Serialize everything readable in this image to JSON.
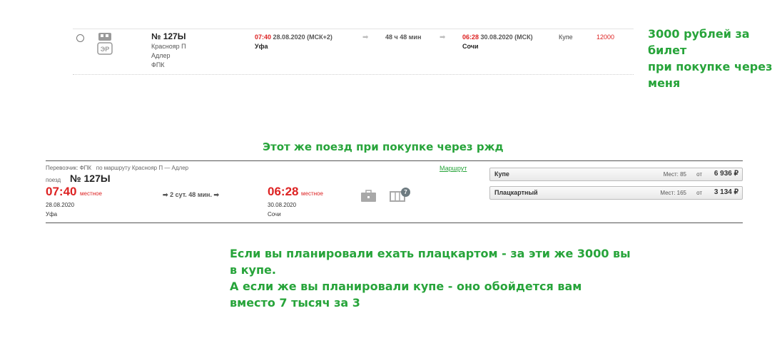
{
  "top_offer": {
    "number": "№ 127Ы",
    "origin": "Краснояр П",
    "destination": "Адлер",
    "carrier": "ФПК",
    "dep_time": "07:40",
    "dep_date": "28.08.2020 (МСК+2)",
    "dep_city": "Уфа",
    "duration": "48 ч 48 мин",
    "arr_time": "06:28",
    "arr_date": "30.08.2020 (МСК)",
    "arr_city": "Сочи",
    "class": "Купе",
    "price": "12000",
    "er_badge": "ЭР"
  },
  "note_top": [
    "3000 рублей за билет",
    "при покупке через",
    "меня"
  ],
  "note_middle": "Этот же поезд при покупке через ржд",
  "rzd": {
    "carrier": "Перевозчик: ФПК",
    "route": "по маршруту Краснояр П — Адлер",
    "route_link": "Маршрут",
    "train_label": "поезд",
    "number": "№ 127Ы",
    "dep_time": "07:40",
    "local_label": "местное",
    "dep_date": "28.08.2020",
    "dep_city": "Уфа",
    "duration": "2 сут. 48 мин.",
    "arr_time": "06:28",
    "arr_date": "30.08.2020",
    "arr_city": "Сочи",
    "car_badge": "7",
    "fares": [
      {
        "label": "Купе",
        "seats": "Мест: 85",
        "from": "от",
        "price": "6 936 ₽"
      },
      {
        "label": "Плацкартный",
        "seats": "Мест: 165",
        "from": "от",
        "price": "3 134 ₽"
      }
    ]
  },
  "note_bottom": [
    "Если вы планировали ехать плацкартом - за эти же 3000 вы",
    "в купе.",
    "А если же вы планировали купе - оно обойдется вам",
    "вместо 7 тысяч за 3"
  ],
  "colors": {
    "accent_green": "#27a43a",
    "time_red": "#dd2222"
  }
}
